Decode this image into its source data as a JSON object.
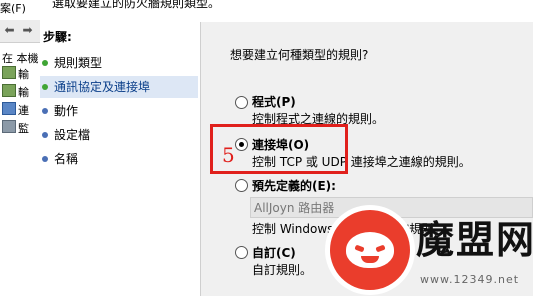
{
  "left_pane": {
    "menu_fragment": "案(F)",
    "tree_root": "在 本機",
    "tree_items": [
      "輸",
      "輸",
      "連",
      "監"
    ]
  },
  "wizard": {
    "subtitle": "選取要建立的防火牆規則類型。",
    "steps_title": "步驟:",
    "steps": [
      {
        "label": "規則類型",
        "state": "done"
      },
      {
        "label": "通訊協定及連接埠",
        "state": "current"
      },
      {
        "label": "動作",
        "state": "todo"
      },
      {
        "label": "設定檔",
        "state": "todo"
      },
      {
        "label": "名稱",
        "state": "todo"
      }
    ],
    "question": "想要建立何種類型的規則?",
    "options": {
      "program": {
        "label": "程式(P)",
        "desc": "控制程式之連線的規則。",
        "checked": false
      },
      "port": {
        "label": "連接埠(O)",
        "desc": "控制 TCP 或 UDP 連接埠之連線的規則。",
        "checked": true
      },
      "predefined": {
        "label": "預先定義的(E):",
        "desc": "控制 Windows 體驗之連線的規則。",
        "checked": false,
        "selected_value": "AllJoyn 路由器"
      },
      "custom": {
        "label": "自訂(C)",
        "desc": "自訂規則。",
        "checked": false
      }
    }
  },
  "annotation": {
    "step_number": "5",
    "color": "#e0201c"
  },
  "watermark": {
    "brand": "魔盟网",
    "url": "www.12349.net",
    "color": "#ea3d2c"
  }
}
